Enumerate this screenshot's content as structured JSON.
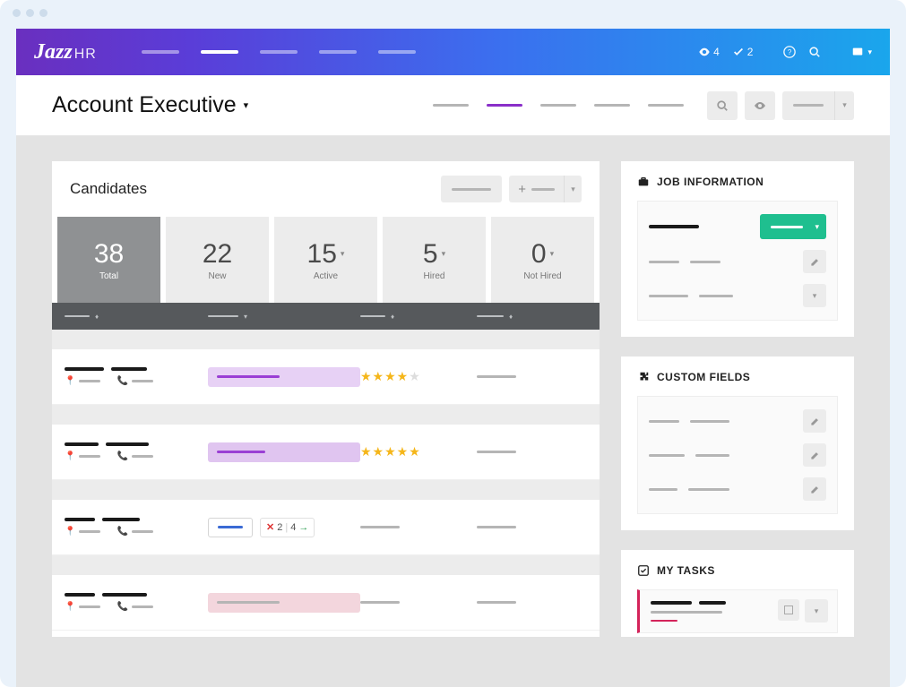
{
  "logo": {
    "main": "Jazz",
    "sub": "HR"
  },
  "topStats": {
    "views": "4",
    "checks": "2"
  },
  "pageTitle": "Account Executive",
  "candidates": {
    "title": "Candidates",
    "stats": [
      {
        "value": "38",
        "label": "Total"
      },
      {
        "value": "22",
        "label": "New"
      },
      {
        "value": "15",
        "label": "Active"
      },
      {
        "value": "5",
        "label": "Hired"
      },
      {
        "value": "0",
        "label": "Not Hired"
      }
    ],
    "rows": [
      {
        "rating": 4,
        "stage": "purple"
      },
      {
        "rating": 5,
        "stage": "purple2"
      },
      {
        "score": {
          "fail": "2",
          "pass": "4"
        },
        "stage": "outline"
      },
      {
        "stage": "pink"
      }
    ]
  },
  "side": {
    "jobInfo": "JOB INFORMATION",
    "customFields": "CUSTOM FIELDS",
    "myTasks": "MY TASKS"
  }
}
